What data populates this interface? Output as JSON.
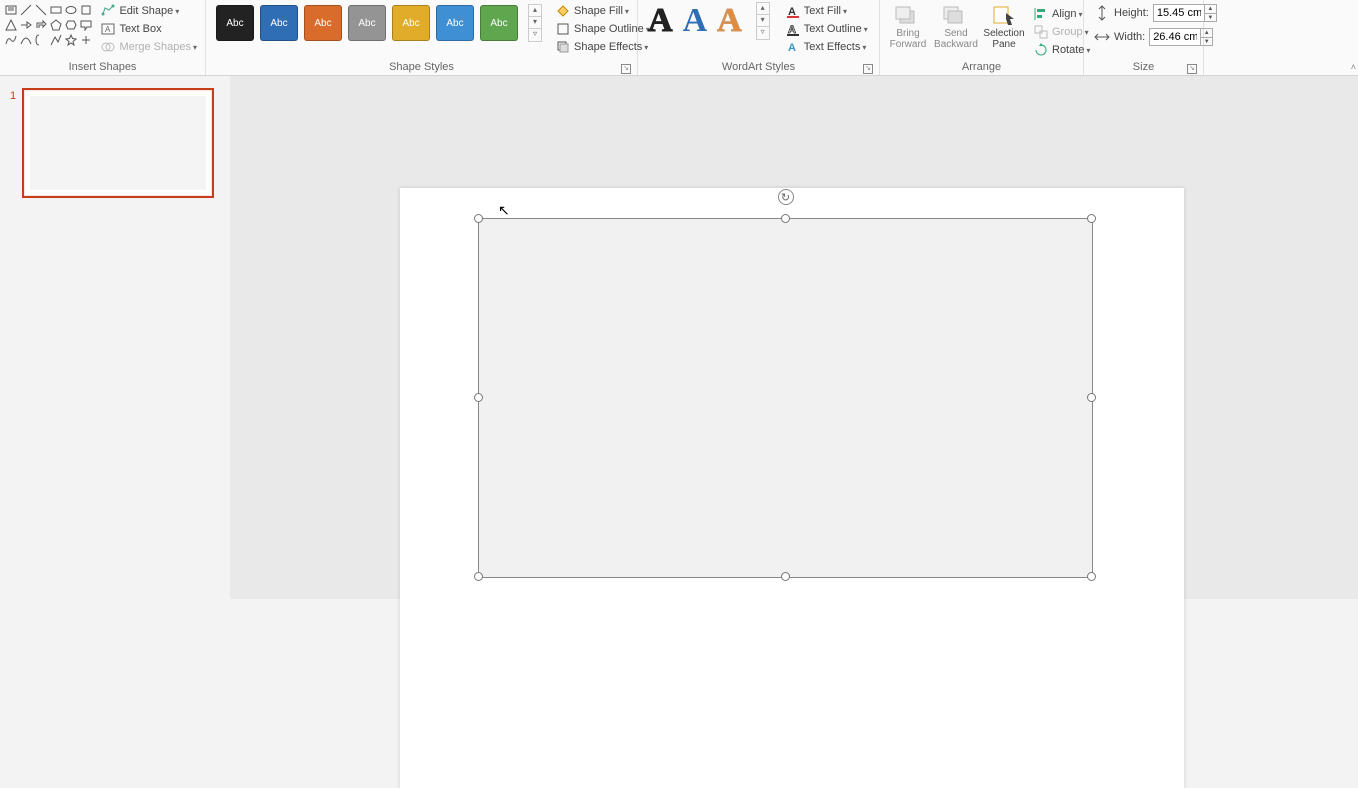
{
  "ribbon": {
    "insert_shapes": {
      "edit_shape": "Edit Shape",
      "text_box": "Text Box",
      "merge_shapes": "Merge Shapes",
      "label": "Insert Shapes"
    },
    "shape_styles": {
      "swatch_text": "Abc",
      "colors": [
        "#222222",
        "#2f6db5",
        "#d96b2b",
        "#949494",
        "#e0ac2a",
        "#3f8fd4",
        "#5fa64f"
      ],
      "fill": "Shape Fill",
      "outline": "Shape Outline",
      "effects": "Shape Effects",
      "label": "Shape Styles"
    },
    "wordart": {
      "glyph": "A",
      "text_fill": "Text Fill",
      "text_outline": "Text Outline",
      "text_effects": "Text Effects",
      "label": "WordArt Styles"
    },
    "arrange": {
      "bring_forward": "Bring Forward",
      "send_backward": "Send Backward",
      "selection_pane": "Selection Pane",
      "align": "Align",
      "group": "Group",
      "rotate": "Rotate",
      "label": "Arrange"
    },
    "size": {
      "height_label": "Height:",
      "height_value": "15.45 cm",
      "width_label": "Width:",
      "width_value": "26.46 cm",
      "label": "Size"
    }
  },
  "thumbnails": {
    "slide1_number": "1"
  }
}
